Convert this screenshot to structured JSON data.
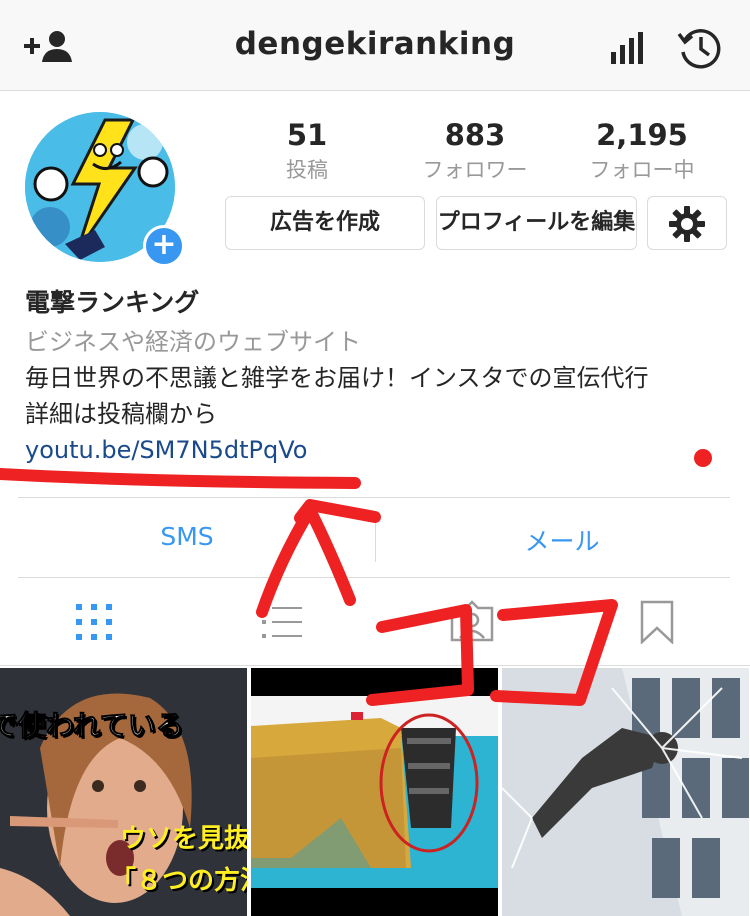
{
  "header": {
    "username": "dengekiranking",
    "icons": [
      "add-user-icon",
      "insights-icon",
      "archive-icon"
    ]
  },
  "profile": {
    "stats": [
      {
        "value": "51",
        "label": "投稿"
      },
      {
        "value": "883",
        "label": "フォロワー"
      },
      {
        "value": "2,195",
        "label": "フォロー中"
      }
    ],
    "buttons": {
      "promote": "広告を作成",
      "edit_profile": "プロフィールを編集",
      "settings_icon": "gear-icon"
    },
    "name": "電撃ランキング",
    "category": "ビジネスや経済のウェブサイト",
    "bio_line1": "毎日世界の不思議と雑学をお届け！インスタでの宣伝代行",
    "bio_line2": "詳細は投稿欄から",
    "link": "youtu.be/SM7N5dtPqVo"
  },
  "contact": {
    "sms": "SMS",
    "email": "メール"
  },
  "tabs": [
    "grid-icon",
    "list-icon",
    "tagged-icon",
    "bookmark-icon"
  ],
  "posts": [
    {
      "overlay_top": "で使われている",
      "overlay_mid": "ウソを見抜",
      "overlay_bot": "「８つの方法"
    },
    {},
    {}
  ],
  "annotation": {
    "text": "ココ",
    "color": "#ee2222"
  }
}
